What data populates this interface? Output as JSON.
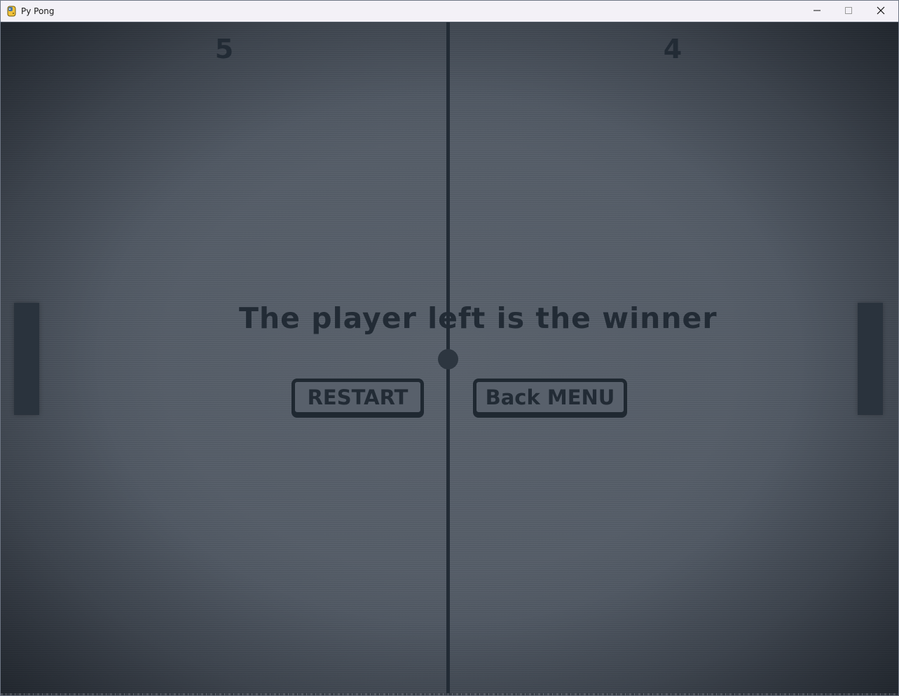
{
  "window": {
    "title": "Py Pong",
    "icon": "python-icon"
  },
  "controls": {
    "minimize_icon": "minimize-icon",
    "maximize_icon": "maximize-icon",
    "close_icon": "close-icon"
  },
  "game": {
    "scores": {
      "left": "5",
      "right": "4"
    },
    "message": "The player left is the winner",
    "buttons": {
      "restart": "RESTART",
      "back_menu": "Back MENU"
    }
  },
  "colors": {
    "background": "#555d68",
    "foreground": "#222b35",
    "paddle": "#2a333d",
    "titlebar": "#f3f1f7"
  }
}
